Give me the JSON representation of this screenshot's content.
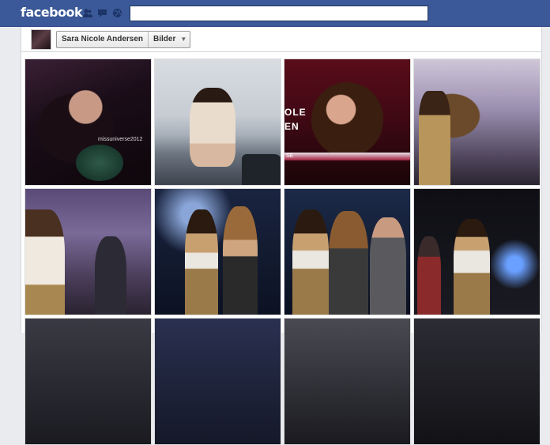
{
  "topbar": {
    "logo": "facebook",
    "search_value": "",
    "icons": [
      "friend-requests-icon",
      "messages-icon",
      "notifications-globe-icon"
    ]
  },
  "album": {
    "owner_name": "Sara Nicole Andersen",
    "section_label": "Bilder",
    "dropdown_icon": "chevron-down-icon"
  },
  "photos": [
    {
      "overlay": "missuniverse2012"
    },
    {
      "overlay": ""
    },
    {
      "overlay_lines": [
        "OLE",
        "EN",
        "SE"
      ]
    },
    {
      "overlay": ""
    },
    {
      "overlay": ""
    },
    {
      "overlay": ""
    },
    {
      "overlay": ""
    },
    {
      "overlay": ""
    }
  ],
  "colors": {
    "brand": "#3b5998",
    "page_bg": "#e9ebee"
  }
}
